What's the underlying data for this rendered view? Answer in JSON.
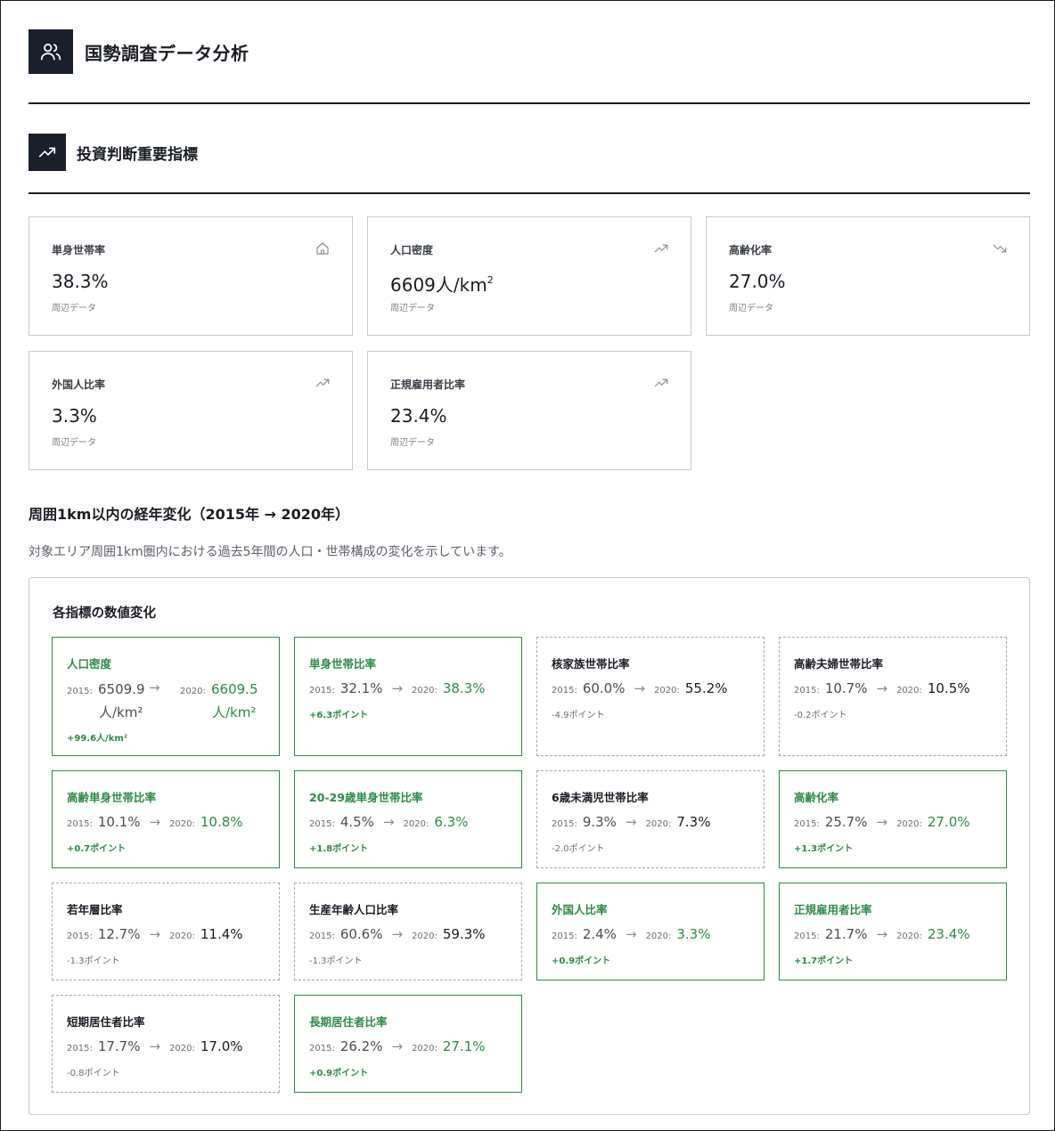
{
  "app": {
    "title": "国勢調査データ分析",
    "icon": "users-icon"
  },
  "section": {
    "title": "投資判断重要指標",
    "icon": "trend-up-icon"
  },
  "kpis": [
    {
      "label": "単身世帯率",
      "value": "38.3%",
      "note": "周辺データ",
      "icon": "home-icon"
    },
    {
      "label": "人口密度",
      "value": "6609人/km",
      "sup": "2",
      "note": "周辺データ",
      "icon": "trend-up-icon"
    },
    {
      "label": "高齢化率",
      "value": "27.0%",
      "note": "周辺データ",
      "icon": "trend-down-icon"
    },
    {
      "label": "外国人比率",
      "value": "3.3%",
      "note": "周辺データ",
      "icon": "trend-up-icon"
    },
    {
      "label": "正規雇用者比率",
      "value": "23.4%",
      "note": "周辺データ",
      "icon": "trend-up-icon"
    }
  ],
  "trend": {
    "title": "周囲1km以内の経年変化（2015年 → 2020年）",
    "description": "対象エリア周囲1km圏内における過去5年間の人口・世帯構成の変化を示しています。",
    "panel_title": "各指標の数値変化",
    "year_from": "2015:",
    "year_to": "2020:",
    "arrow": "→",
    "density": {
      "title": "人口密度",
      "v2015": "6509.9",
      "v2020": "6609.5",
      "unit": "人/km²",
      "delta": "+99.6人/km²"
    },
    "cards": [
      {
        "title": "単身世帯比率",
        "v2015": "32.1%",
        "v2020": "38.3%",
        "delta": "+6.3ポイント",
        "status": "pos"
      },
      {
        "title": "核家族世帯比率",
        "v2015": "60.0%",
        "v2020": "55.2%",
        "delta": "-4.9ポイント",
        "status": "neu"
      },
      {
        "title": "高齢夫婦世帯比率",
        "v2015": "10.7%",
        "v2020": "10.5%",
        "delta": "-0.2ポイント",
        "status": "neu"
      },
      {
        "title": "高齢単身世帯比率",
        "v2015": "10.1%",
        "v2020": "10.8%",
        "delta": "+0.7ポイント",
        "status": "pos"
      },
      {
        "title": "20-29歳単身世帯比率",
        "v2015": "4.5%",
        "v2020": "6.3%",
        "delta": "+1.8ポイント",
        "status": "pos"
      },
      {
        "title": "6歳未満児世帯比率",
        "v2015": "9.3%",
        "v2020": "7.3%",
        "delta": "-2.0ポイント",
        "status": "neu"
      },
      {
        "title": "高齢化率",
        "v2015": "25.7%",
        "v2020": "27.0%",
        "delta": "+1.3ポイント",
        "status": "pos"
      },
      {
        "title": "若年層比率",
        "v2015": "12.7%",
        "v2020": "11.4%",
        "delta": "-1.3ポイント",
        "status": "neu"
      },
      {
        "title": "生産年齢人口比率",
        "v2015": "60.6%",
        "v2020": "59.3%",
        "delta": "-1.3ポイント",
        "status": "neu"
      },
      {
        "title": "外国人比率",
        "v2015": "2.4%",
        "v2020": "3.3%",
        "delta": "+0.9ポイント",
        "status": "pos"
      },
      {
        "title": "正規雇用者比率",
        "v2015": "21.7%",
        "v2020": "23.4%",
        "delta": "+1.7ポイント",
        "status": "pos"
      },
      {
        "title": "短期居住者比率",
        "v2015": "17.7%",
        "v2020": "17.0%",
        "delta": "-0.8ポイント",
        "status": "neu"
      },
      {
        "title": "長期居住者比率",
        "v2015": "26.2%",
        "v2020": "27.1%",
        "delta": "+0.9ポイント",
        "status": "pos"
      }
    ]
  },
  "colors": {
    "positive": "#2e8b47",
    "dark": "#1a1f2c",
    "border": "#c6c9cf"
  }
}
